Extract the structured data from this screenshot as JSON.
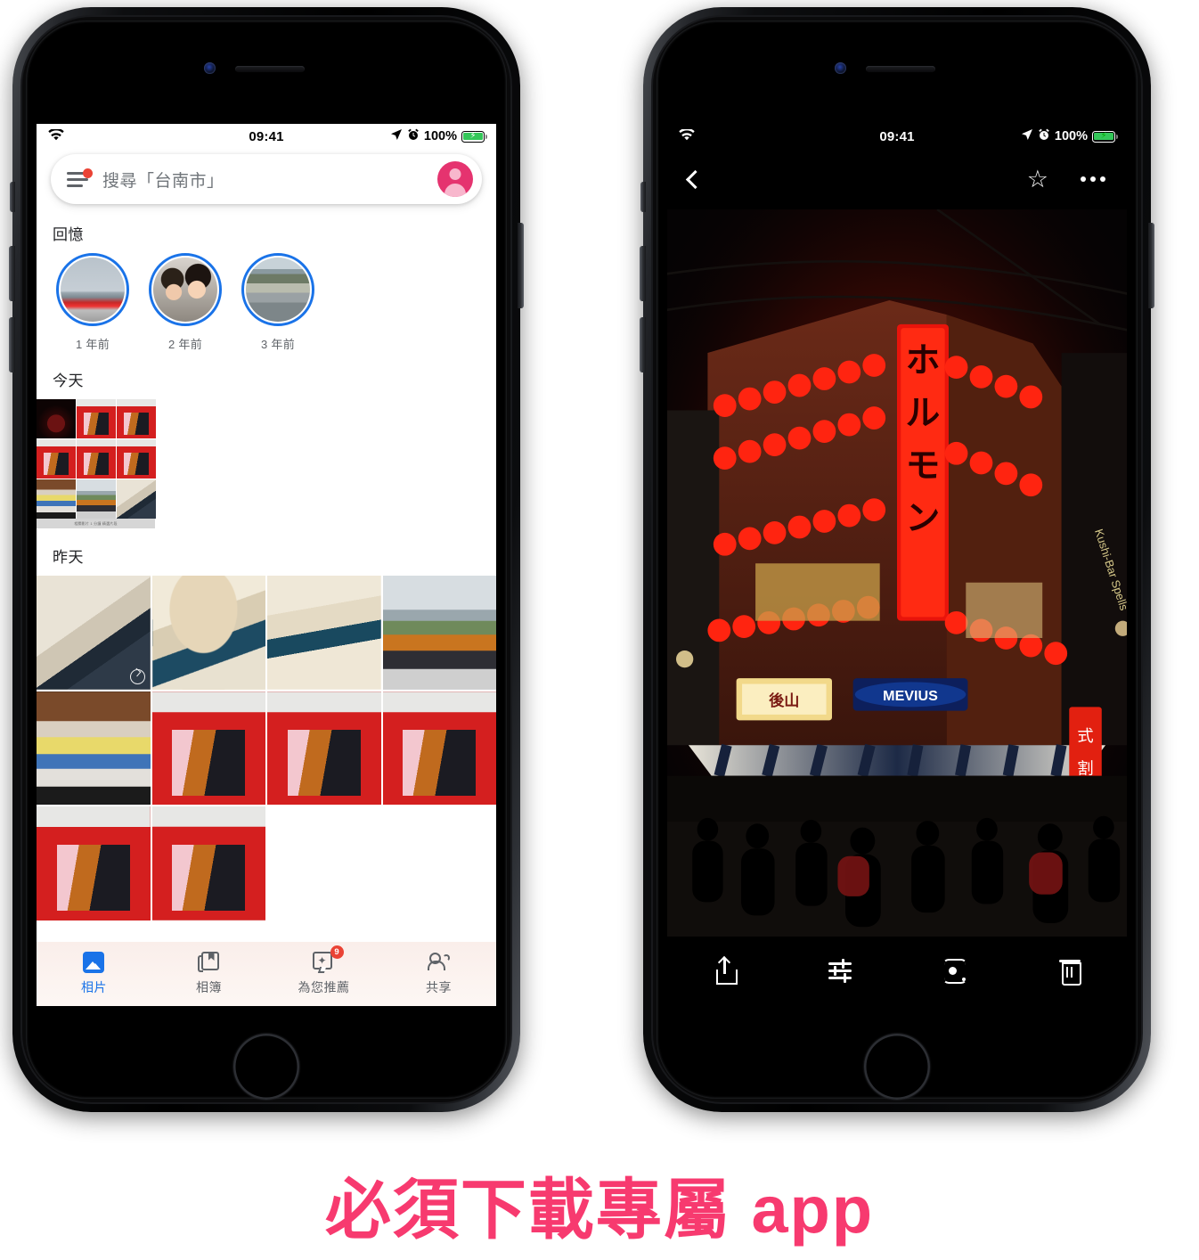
{
  "caption": {
    "text": "必須下載專屬 app"
  },
  "phones": {
    "left": {
      "statusbar": {
        "wifi_icon": "wifi-icon",
        "time": "09:41",
        "location_icon": "location-arrow-icon",
        "alarm_icon": "alarm-clock-icon",
        "battery_percent": "100%",
        "battery_icon": "battery-charging-icon"
      },
      "search": {
        "menu_icon": "hamburger-menu-icon",
        "notification_dot": "red-dot-badge",
        "placeholder": "搜尋「台南市」",
        "avatar_icon": "account-avatar-icon"
      },
      "sections": [
        {
          "title": "回憶"
        },
        {
          "title": "今天"
        },
        {
          "title": "昨天"
        }
      ],
      "memories": [
        {
          "label": "1 年前",
          "thumb_class": "m1"
        },
        {
          "label": "2 年前",
          "thumb_class": "m2"
        },
        {
          "label": "3 年前",
          "thumb_class": "m3"
        }
      ],
      "today_grid": {
        "cells": [
          "p-night",
          "p-red",
          "p-red",
          "p-red",
          "p-red",
          "p-red",
          "p-stuff",
          "p-girl",
          "p-dog1"
        ],
        "caption_strip": "相關影片 1 分鐘 精選片段"
      },
      "yesterday_grid": {
        "cells": [
          "p-dog1",
          "p-dog2",
          "p-dog3",
          "p-girl",
          "p-stuff",
          "p-red",
          "p-red",
          "p-red",
          "p-red",
          "p-red"
        ],
        "loop_badge_on_cell": 0
      },
      "tabbar": [
        {
          "label": "相片",
          "icon": "photos-icon",
          "active": true,
          "badge": ""
        },
        {
          "label": "相簿",
          "icon": "albums-icon",
          "active": false,
          "badge": ""
        },
        {
          "label": "為您推薦",
          "icon": "for-you-sparkle-icon",
          "active": false,
          "badge": "9"
        },
        {
          "label": "共享",
          "icon": "shared-people-icon",
          "active": false,
          "badge": ""
        }
      ]
    },
    "right": {
      "statusbar": {
        "wifi_icon": "wifi-icon",
        "time": "09:41",
        "location_icon": "location-arrow-icon",
        "alarm_icon": "alarm-clock-icon",
        "battery_percent": "100%",
        "battery_icon": "battery-charging-icon"
      },
      "topbar": {
        "back_icon": "back-chevron-icon",
        "favorite_icon": "star-outline-icon",
        "overflow_icon": "more-options-icon"
      },
      "photo": {
        "description": "日本夜間街景 紅色燈籠 ホルモン 霓虹招牌",
        "signs": [
          "ホルモン",
          "MEVIUS"
        ]
      },
      "toolbar": [
        {
          "label": "分享",
          "icon": "share-icon"
        },
        {
          "label": "編輯",
          "icon": "edit-sliders-icon"
        },
        {
          "label": "鏡頭",
          "icon": "google-lens-icon"
        },
        {
          "label": "刪除",
          "icon": "trash-icon"
        }
      ]
    }
  },
  "colors": {
    "accent_blue": "#1a73e8",
    "badge_red": "#ea4335",
    "avatar_pink": "#e5336f",
    "caption_pink": "#f73a6f",
    "battery_green": "#34c759"
  }
}
